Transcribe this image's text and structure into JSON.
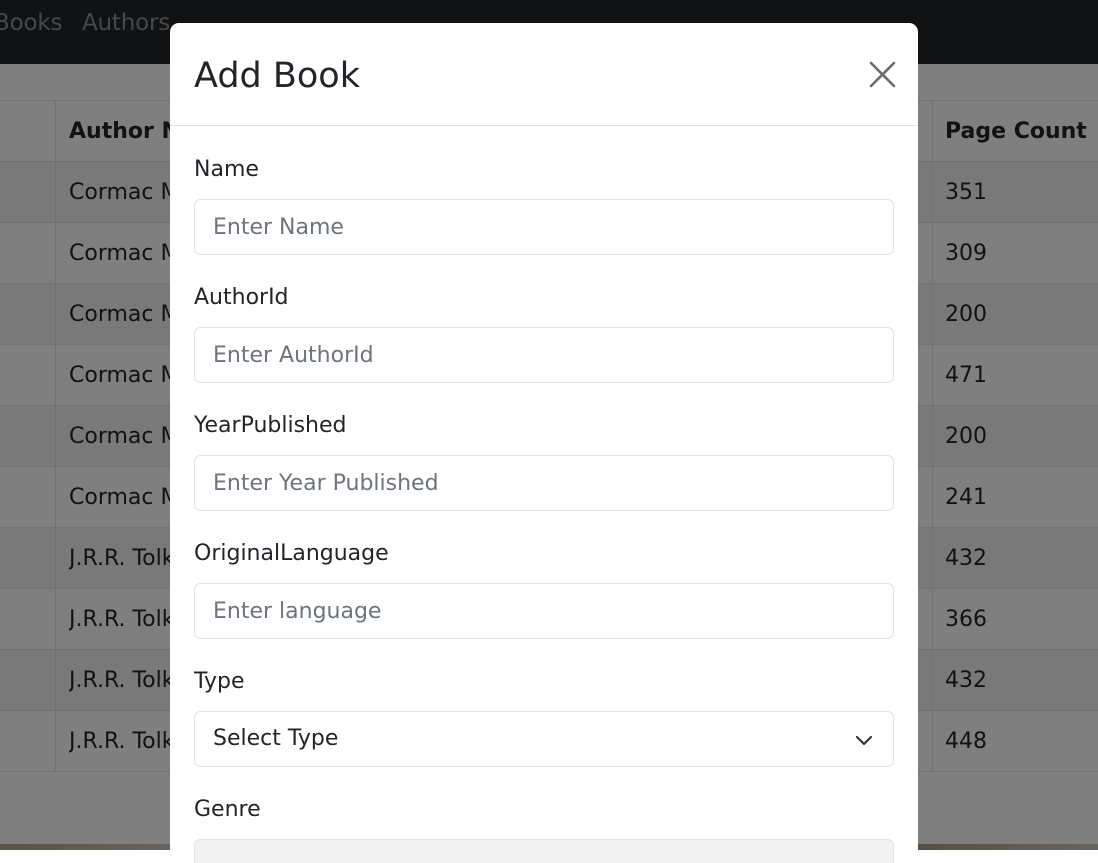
{
  "navbar": {
    "links": [
      "Books",
      "Authors"
    ]
  },
  "table": {
    "headers": {
      "author": "Author N",
      "pages": "Page Count"
    },
    "rows": [
      {
        "author": "Cormac M",
        "pages": "351"
      },
      {
        "author": "Cormac M",
        "pages": "309"
      },
      {
        "author": "Cormac M",
        "pages": "200"
      },
      {
        "author": "Cormac M",
        "pages": "471"
      },
      {
        "author": "Cormac M",
        "pages": "200"
      },
      {
        "author": "Cormac M",
        "pages": "241"
      },
      {
        "author": "J.R.R. Tolk",
        "pages": "432"
      },
      {
        "author": "J.R.R. Tolk",
        "pages": "366"
      },
      {
        "author": "J.R.R. Tolk",
        "pages": "432"
      },
      {
        "author": "J.R.R. Tolk",
        "pages": "448"
      }
    ]
  },
  "modal": {
    "title": "Add Book",
    "close_icon": "close-icon",
    "fields": {
      "name": {
        "label": "Name",
        "placeholder": "Enter Name"
      },
      "author_id": {
        "label": "AuthorId",
        "placeholder": "Enter AuthorId"
      },
      "year_published": {
        "label": "YearPublished",
        "placeholder": "Enter Year Published"
      },
      "original_language": {
        "label": "OriginalLanguage",
        "placeholder": "Enter language"
      },
      "type": {
        "label": "Type",
        "selected": "Select Type"
      },
      "genre": {
        "label": "Genre"
      }
    }
  },
  "colors": {
    "navbar": "#212529",
    "backdrop": "rgba(0,0,0,0.5)",
    "border": "#dee2e6",
    "placeholder": "#6c757d",
    "text": "#212529"
  }
}
